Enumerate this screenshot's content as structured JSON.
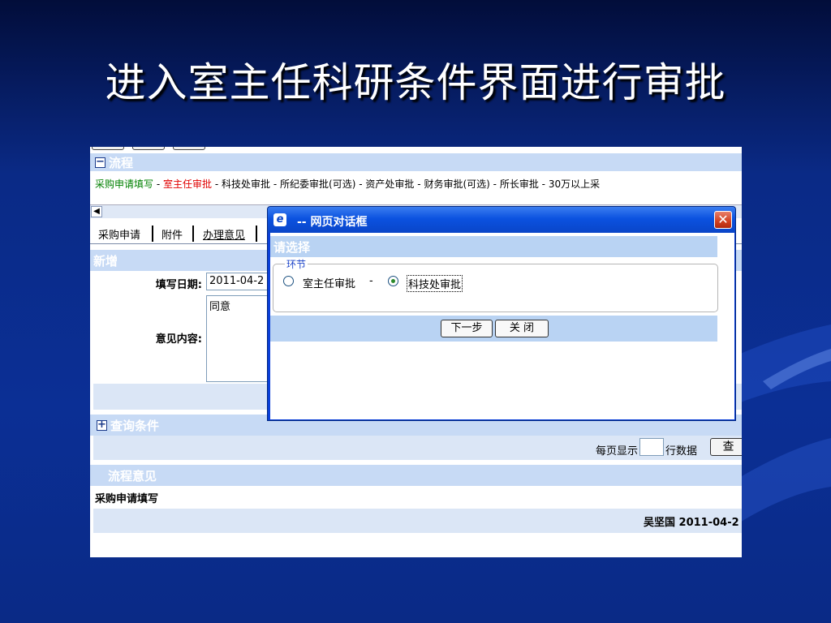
{
  "slide": {
    "title": "进入室主任科研条件界面进行审批"
  },
  "colors": {
    "slide_background": "#0b2f95",
    "dialog_frame": "#0a3fd8",
    "section_bar": "#c7daf5",
    "current_step": "#e00000",
    "flow_link": "#008000"
  },
  "app": {
    "process_section": "流程",
    "flow_steps": [
      "采购申请填写",
      "室主任审批",
      "科技处审批",
      "所纪委审批(可选)",
      "资产处审批",
      "财务审批(可选)",
      "所长审批",
      "30万以上采"
    ],
    "flow_separator": "-",
    "tabs": [
      "采购申请",
      "附件",
      "办理意见"
    ],
    "active_tab": "办理意见",
    "new_section": "新增",
    "date_label": "填写日期:",
    "date_value": "2011-04-2",
    "opinion_label": "意见内容:",
    "opinion_value": "同意",
    "query_section": "查询条件",
    "per_page_prefix": "每页显示",
    "per_page_suffix": "行数据",
    "query_button": "查",
    "flow_opinion_section": "流程意见",
    "flow_opinion_row_step": "采购申请填写",
    "flow_opinion_row_sign": "吴坚国 2011-04-2"
  },
  "dialog": {
    "title": "-- 网页对话框",
    "header": "请选择",
    "legend": "环节",
    "options": [
      {
        "label": "室主任审批",
        "checked": false
      },
      {
        "label": "科技处审批",
        "checked": true
      }
    ],
    "option_separator": "-",
    "next_button": "下一步",
    "close_button": "关 闭"
  }
}
